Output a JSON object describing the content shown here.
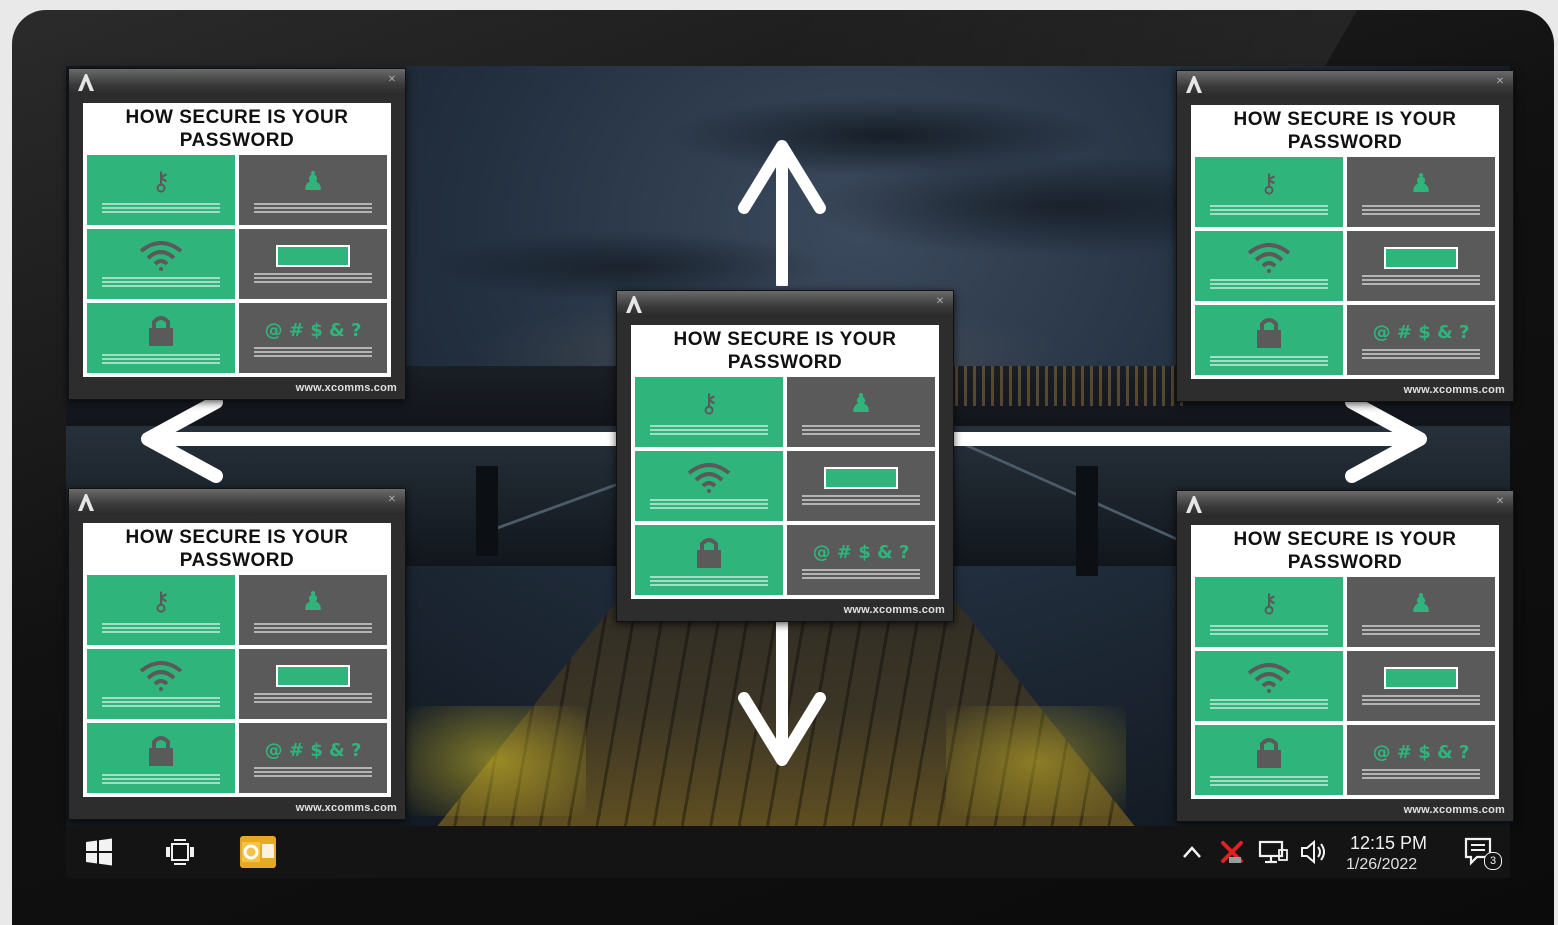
{
  "popup": {
    "title": "HOW SECURE IS YOUR",
    "title_line2": "PASSWORD",
    "website": "www.xcomms.com",
    "symbols": "@ # $ & ?"
  },
  "taskbar": {
    "time": "12:15 PM",
    "date": "1/26/2022",
    "notification_count": "3",
    "icons": [
      "windows-start-icon",
      "task-view-icon",
      "outlook-icon",
      "show-hidden-icons-chevron",
      "security-alert-icon",
      "network-icon",
      "volume-icon",
      "action-center-icon"
    ]
  },
  "colors": {
    "tile_green": "#2fb57c",
    "tile_gray": "#5a5a5a",
    "taskbar": "#141414"
  }
}
